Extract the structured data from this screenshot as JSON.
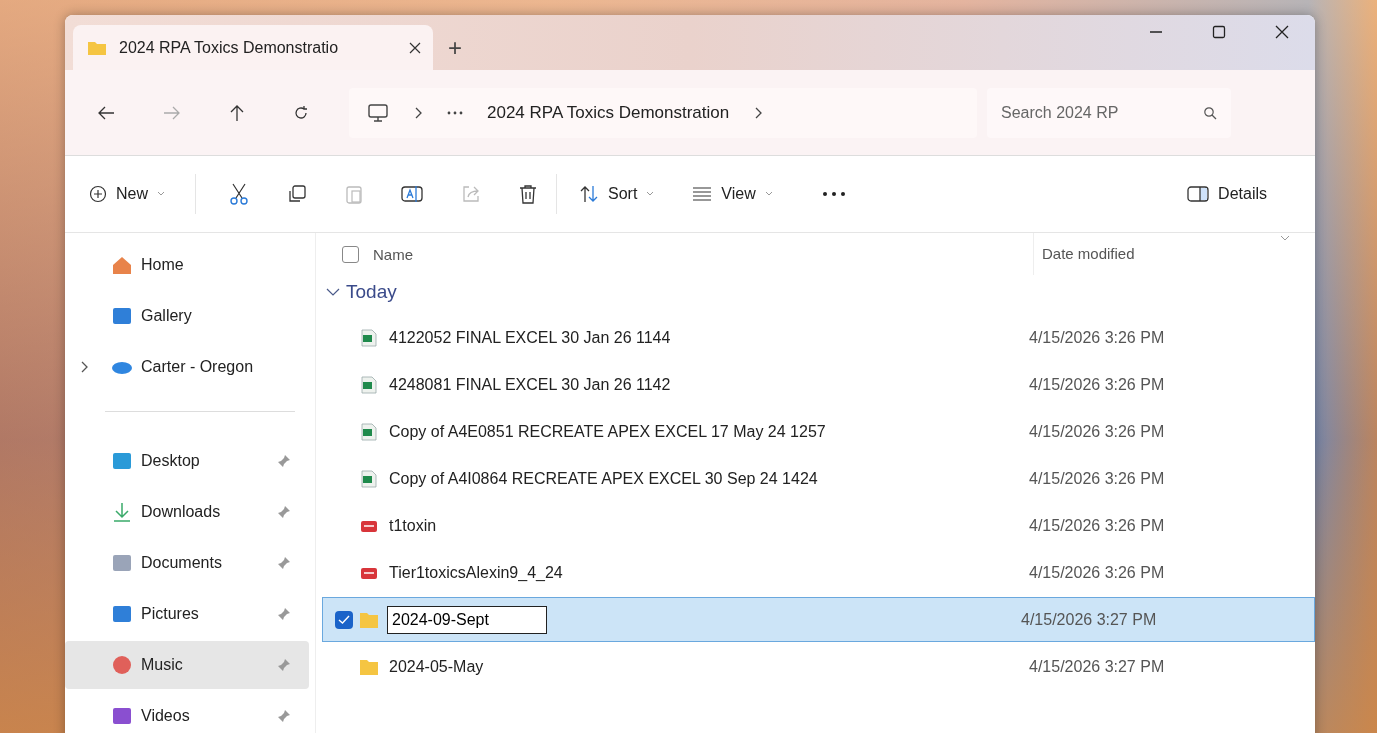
{
  "tabs": [
    {
      "title": "2024 RPA Toxics Demonstratio",
      "selected": true
    }
  ],
  "new_tab": "+",
  "breadcrumb": {
    "items": [
      "2024 RPA Toxics Demonstration"
    ]
  },
  "search": {
    "placeholder": "Search 2024 RP"
  },
  "toolbar": {
    "new": "New",
    "sort": "Sort",
    "view": "View",
    "details": "Details"
  },
  "sidebar": {
    "items": [
      {
        "label": "Home",
        "kind": "home",
        "pinned": false,
        "selected": false,
        "expandable": false
      },
      {
        "label": "Gallery",
        "kind": "gallery",
        "pinned": false,
        "selected": false,
        "expandable": false
      },
      {
        "label": "Carter - Oregon",
        "kind": "cloud",
        "pinned": false,
        "selected": false,
        "expandable": true
      },
      {
        "label": "Desktop",
        "kind": "desktop",
        "pinned": true,
        "selected": false,
        "expandable": false
      },
      {
        "label": "Downloads",
        "kind": "downloads",
        "pinned": true,
        "selected": false,
        "expandable": false
      },
      {
        "label": "Documents",
        "kind": "documents",
        "pinned": true,
        "selected": false,
        "expandable": false
      },
      {
        "label": "Pictures",
        "kind": "pictures",
        "pinned": true,
        "selected": false,
        "expandable": false
      },
      {
        "label": "Music",
        "kind": "music",
        "pinned": true,
        "selected": true,
        "expandable": false
      },
      {
        "label": "Videos",
        "kind": "videos",
        "pinned": true,
        "selected": false,
        "expandable": false
      }
    ]
  },
  "table": {
    "select_all_checked": false,
    "columns": [
      "Name",
      "Date modified"
    ],
    "group": "Today",
    "group_expanded": true,
    "rows": [
      {
        "name": "4122052 FINAL EXCEL 30 Jan 26 1144",
        "kind": "excel",
        "date": "4/15/2026 3:26 PM",
        "selected": false,
        "renaming": false
      },
      {
        "name": "4248081 FINAL EXCEL 30 Jan 26 1142",
        "kind": "excel",
        "date": "4/15/2026 3:26 PM",
        "selected": false,
        "renaming": false
      },
      {
        "name": "Copy of A4E0851 RECREATE APEX EXCEL 17 May 24 1257",
        "kind": "excel",
        "date": "4/15/2026 3:26 PM",
        "selected": false,
        "renaming": false
      },
      {
        "name": "Copy of A4I0864 RECREATE APEX EXCEL 30 Sep 24 1424",
        "kind": "excel",
        "date": "4/15/2026 3:26 PM",
        "selected": false,
        "renaming": false
      },
      {
        "name": "t1toxin",
        "kind": "pdf",
        "date": "4/15/2026 3:26 PM",
        "selected": false,
        "renaming": false
      },
      {
        "name": "Tier1toxicsAlexin9_4_24",
        "kind": "pdf",
        "date": "4/15/2026 3:26 PM",
        "selected": false,
        "renaming": false
      },
      {
        "name": "2024-09-Sept",
        "kind": "folder",
        "date": "4/15/2026 3:27 PM",
        "selected": true,
        "renaming": true
      },
      {
        "name": "2024-05-May",
        "kind": "folder",
        "date": "4/15/2026 3:27 PM",
        "selected": false,
        "renaming": false
      }
    ]
  }
}
